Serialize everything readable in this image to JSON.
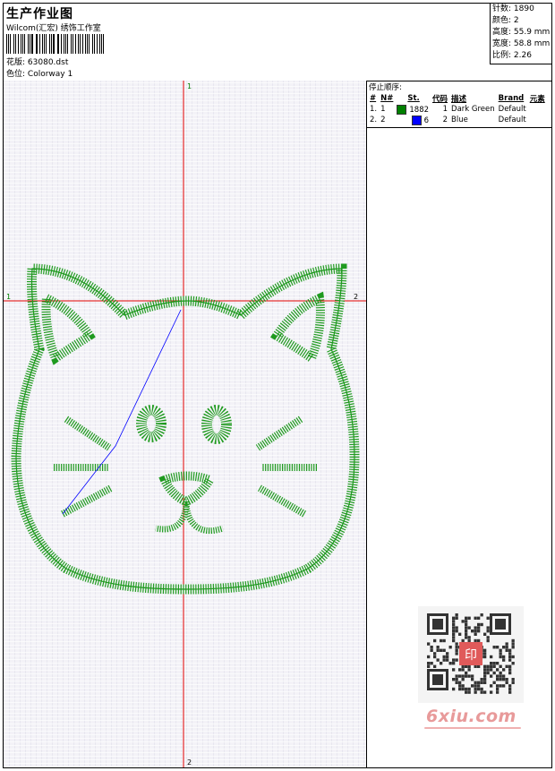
{
  "header": {
    "title": "生产作业图",
    "studio": "Wilcom(汇宏) 绣饰工作室",
    "design_label": "花版:",
    "design_value": "63080.dst",
    "colorway_label": "色位:",
    "colorway_value": "Colorway 1"
  },
  "stats": {
    "stitches": "针数: 1890",
    "colors": "颜色: 2",
    "height": "高度: 55.9 mm",
    "width": "宽度: 58.8 mm",
    "scale": "比例: 2.26"
  },
  "stop_sequence": {
    "title": "停止顺序:",
    "columns": [
      "#",
      "N#",
      "St.",
      "代码",
      "描述",
      "Brand",
      "元素"
    ],
    "rows": [
      {
        "num": "1.",
        "needle": "1",
        "swatch": "#008000",
        "stitches": "1882",
        "code": "1",
        "desc": "Dark Green",
        "brand": "Default"
      },
      {
        "num": "2.",
        "needle": "2",
        "swatch": "#0000ff",
        "stitches": "6",
        "code": "2",
        "desc": "Blue",
        "brand": "Default"
      }
    ]
  },
  "axes": {
    "top": "1",
    "bottom": "2",
    "left": "1",
    "right": "2"
  },
  "watermark": {
    "text": "6xiu.com",
    "stamp": "印"
  },
  "colors": {
    "thread_green": "#1f9a1f",
    "jump_blue": "#0000ff",
    "guide_red": "#e00000"
  }
}
